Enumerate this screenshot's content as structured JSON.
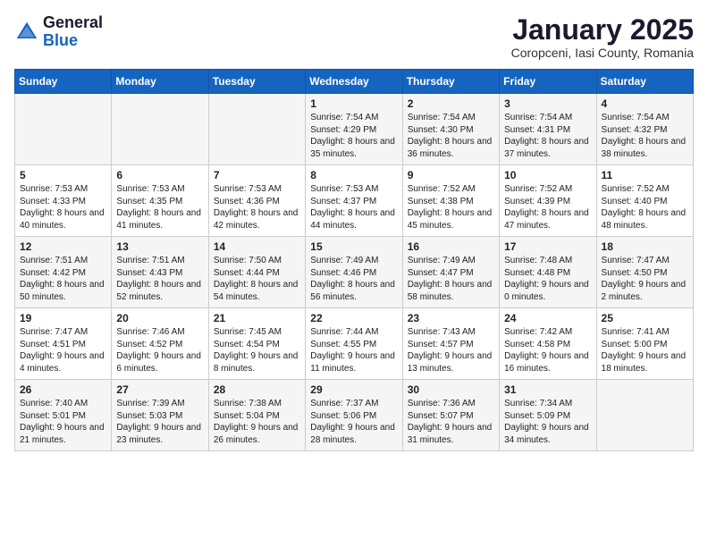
{
  "logo": {
    "general": "General",
    "blue": "Blue"
  },
  "title": "January 2025",
  "subtitle": "Coropceni, Iasi County, Romania",
  "days_of_week": [
    "Sunday",
    "Monday",
    "Tuesday",
    "Wednesday",
    "Thursday",
    "Friday",
    "Saturday"
  ],
  "weeks": [
    [
      {
        "day": "",
        "sunrise": "",
        "sunset": "",
        "daylight": ""
      },
      {
        "day": "",
        "sunrise": "",
        "sunset": "",
        "daylight": ""
      },
      {
        "day": "",
        "sunrise": "",
        "sunset": "",
        "daylight": ""
      },
      {
        "day": "1",
        "sunrise": "Sunrise: 7:54 AM",
        "sunset": "Sunset: 4:29 PM",
        "daylight": "Daylight: 8 hours and 35 minutes."
      },
      {
        "day": "2",
        "sunrise": "Sunrise: 7:54 AM",
        "sunset": "Sunset: 4:30 PM",
        "daylight": "Daylight: 8 hours and 36 minutes."
      },
      {
        "day": "3",
        "sunrise": "Sunrise: 7:54 AM",
        "sunset": "Sunset: 4:31 PM",
        "daylight": "Daylight: 8 hours and 37 minutes."
      },
      {
        "day": "4",
        "sunrise": "Sunrise: 7:54 AM",
        "sunset": "Sunset: 4:32 PM",
        "daylight": "Daylight: 8 hours and 38 minutes."
      }
    ],
    [
      {
        "day": "5",
        "sunrise": "Sunrise: 7:53 AM",
        "sunset": "Sunset: 4:33 PM",
        "daylight": "Daylight: 8 hours and 40 minutes."
      },
      {
        "day": "6",
        "sunrise": "Sunrise: 7:53 AM",
        "sunset": "Sunset: 4:35 PM",
        "daylight": "Daylight: 8 hours and 41 minutes."
      },
      {
        "day": "7",
        "sunrise": "Sunrise: 7:53 AM",
        "sunset": "Sunset: 4:36 PM",
        "daylight": "Daylight: 8 hours and 42 minutes."
      },
      {
        "day": "8",
        "sunrise": "Sunrise: 7:53 AM",
        "sunset": "Sunset: 4:37 PM",
        "daylight": "Daylight: 8 hours and 44 minutes."
      },
      {
        "day": "9",
        "sunrise": "Sunrise: 7:52 AM",
        "sunset": "Sunset: 4:38 PM",
        "daylight": "Daylight: 8 hours and 45 minutes."
      },
      {
        "day": "10",
        "sunrise": "Sunrise: 7:52 AM",
        "sunset": "Sunset: 4:39 PM",
        "daylight": "Daylight: 8 hours and 47 minutes."
      },
      {
        "day": "11",
        "sunrise": "Sunrise: 7:52 AM",
        "sunset": "Sunset: 4:40 PM",
        "daylight": "Daylight: 8 hours and 48 minutes."
      }
    ],
    [
      {
        "day": "12",
        "sunrise": "Sunrise: 7:51 AM",
        "sunset": "Sunset: 4:42 PM",
        "daylight": "Daylight: 8 hours and 50 minutes."
      },
      {
        "day": "13",
        "sunrise": "Sunrise: 7:51 AM",
        "sunset": "Sunset: 4:43 PM",
        "daylight": "Daylight: 8 hours and 52 minutes."
      },
      {
        "day": "14",
        "sunrise": "Sunrise: 7:50 AM",
        "sunset": "Sunset: 4:44 PM",
        "daylight": "Daylight: 8 hours and 54 minutes."
      },
      {
        "day": "15",
        "sunrise": "Sunrise: 7:49 AM",
        "sunset": "Sunset: 4:46 PM",
        "daylight": "Daylight: 8 hours and 56 minutes."
      },
      {
        "day": "16",
        "sunrise": "Sunrise: 7:49 AM",
        "sunset": "Sunset: 4:47 PM",
        "daylight": "Daylight: 8 hours and 58 minutes."
      },
      {
        "day": "17",
        "sunrise": "Sunrise: 7:48 AM",
        "sunset": "Sunset: 4:48 PM",
        "daylight": "Daylight: 9 hours and 0 minutes."
      },
      {
        "day": "18",
        "sunrise": "Sunrise: 7:47 AM",
        "sunset": "Sunset: 4:50 PM",
        "daylight": "Daylight: 9 hours and 2 minutes."
      }
    ],
    [
      {
        "day": "19",
        "sunrise": "Sunrise: 7:47 AM",
        "sunset": "Sunset: 4:51 PM",
        "daylight": "Daylight: 9 hours and 4 minutes."
      },
      {
        "day": "20",
        "sunrise": "Sunrise: 7:46 AM",
        "sunset": "Sunset: 4:52 PM",
        "daylight": "Daylight: 9 hours and 6 minutes."
      },
      {
        "day": "21",
        "sunrise": "Sunrise: 7:45 AM",
        "sunset": "Sunset: 4:54 PM",
        "daylight": "Daylight: 9 hours and 8 minutes."
      },
      {
        "day": "22",
        "sunrise": "Sunrise: 7:44 AM",
        "sunset": "Sunset: 4:55 PM",
        "daylight": "Daylight: 9 hours and 11 minutes."
      },
      {
        "day": "23",
        "sunrise": "Sunrise: 7:43 AM",
        "sunset": "Sunset: 4:57 PM",
        "daylight": "Daylight: 9 hours and 13 minutes."
      },
      {
        "day": "24",
        "sunrise": "Sunrise: 7:42 AM",
        "sunset": "Sunset: 4:58 PM",
        "daylight": "Daylight: 9 hours and 16 minutes."
      },
      {
        "day": "25",
        "sunrise": "Sunrise: 7:41 AM",
        "sunset": "Sunset: 5:00 PM",
        "daylight": "Daylight: 9 hours and 18 minutes."
      }
    ],
    [
      {
        "day": "26",
        "sunrise": "Sunrise: 7:40 AM",
        "sunset": "Sunset: 5:01 PM",
        "daylight": "Daylight: 9 hours and 21 minutes."
      },
      {
        "day": "27",
        "sunrise": "Sunrise: 7:39 AM",
        "sunset": "Sunset: 5:03 PM",
        "daylight": "Daylight: 9 hours and 23 minutes."
      },
      {
        "day": "28",
        "sunrise": "Sunrise: 7:38 AM",
        "sunset": "Sunset: 5:04 PM",
        "daylight": "Daylight: 9 hours and 26 minutes."
      },
      {
        "day": "29",
        "sunrise": "Sunrise: 7:37 AM",
        "sunset": "Sunset: 5:06 PM",
        "daylight": "Daylight: 9 hours and 28 minutes."
      },
      {
        "day": "30",
        "sunrise": "Sunrise: 7:36 AM",
        "sunset": "Sunset: 5:07 PM",
        "daylight": "Daylight: 9 hours and 31 minutes."
      },
      {
        "day": "31",
        "sunrise": "Sunrise: 7:34 AM",
        "sunset": "Sunset: 5:09 PM",
        "daylight": "Daylight: 9 hours and 34 minutes."
      },
      {
        "day": "",
        "sunrise": "",
        "sunset": "",
        "daylight": ""
      }
    ]
  ]
}
